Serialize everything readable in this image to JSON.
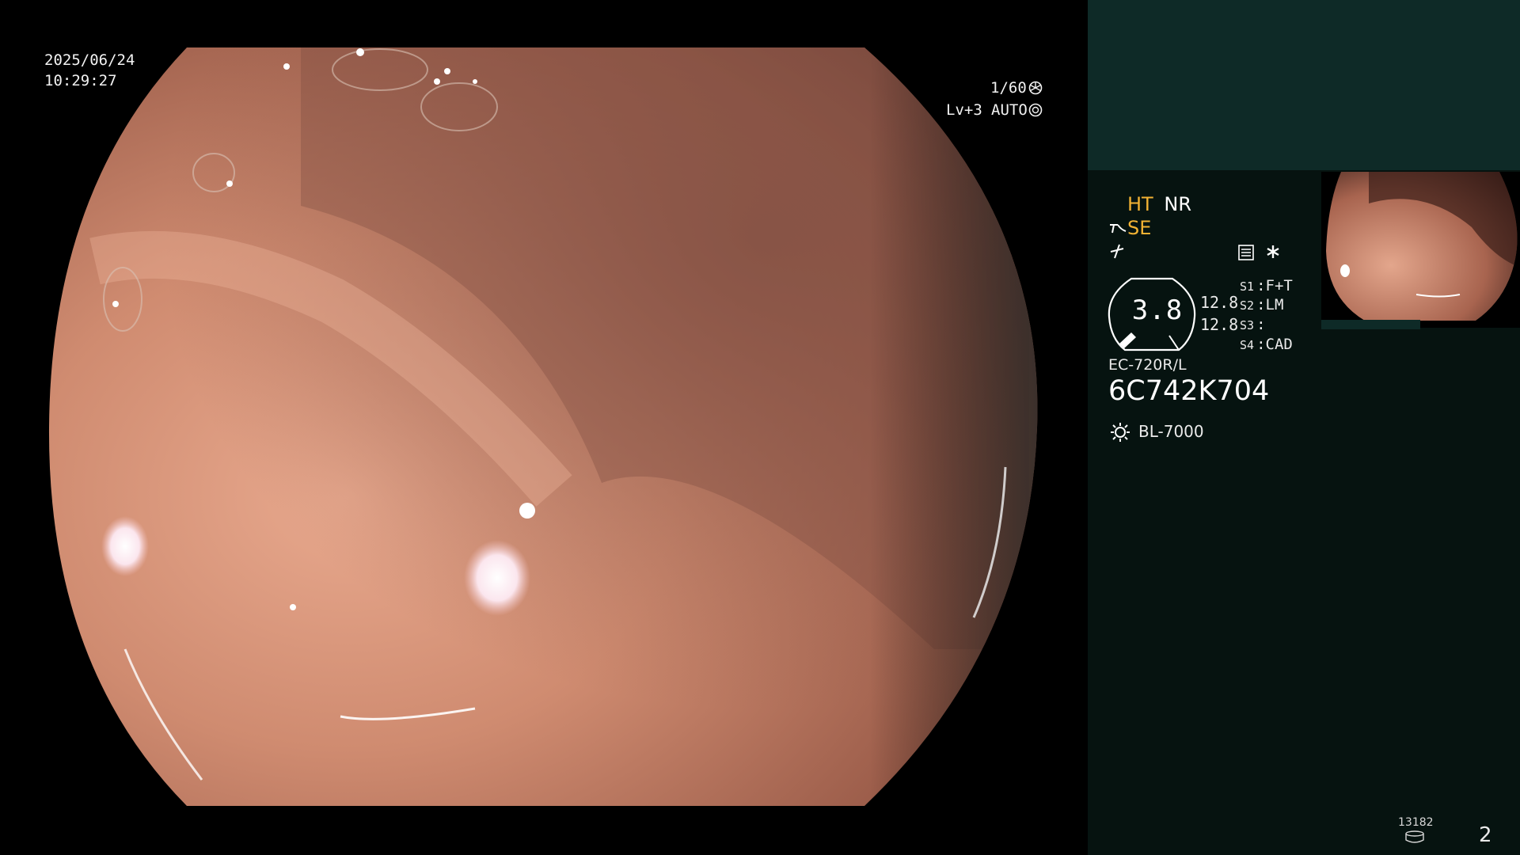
{
  "datetime": {
    "date": "2025/06/24",
    "time": "10:29:27"
  },
  "shutter": {
    "value": "1/60",
    "icon": "shutter-icon"
  },
  "exposure": {
    "level": "Lv+3",
    "mode": "AUTO",
    "icon": "iris-icon"
  },
  "modes": {
    "ht": "HT",
    "nr": "NR",
    "se": "SE",
    "colors": {
      "active": "#f2b233",
      "inactive": "#ffffff"
    }
  },
  "gauge": {
    "value": "3.8",
    "top": "12.8",
    "bottom": "12.8"
  },
  "slots": [
    {
      "key": "S1",
      "value": "F+T"
    },
    {
      "key": "S2",
      "value": "LM"
    },
    {
      "key": "S3",
      "value": ""
    },
    {
      "key": "S4",
      "value": "CAD"
    }
  ],
  "scope": {
    "model": "EC-720R/L",
    "serial": "6C742K704"
  },
  "light_source": {
    "name": "BL-7000",
    "icon": "light-source-icon"
  },
  "storage": {
    "count": "13182",
    "icon": "storage-disk-icon"
  },
  "page_number": "2",
  "panel_colors": {
    "top": "#0e2a27",
    "main": "#061310"
  }
}
